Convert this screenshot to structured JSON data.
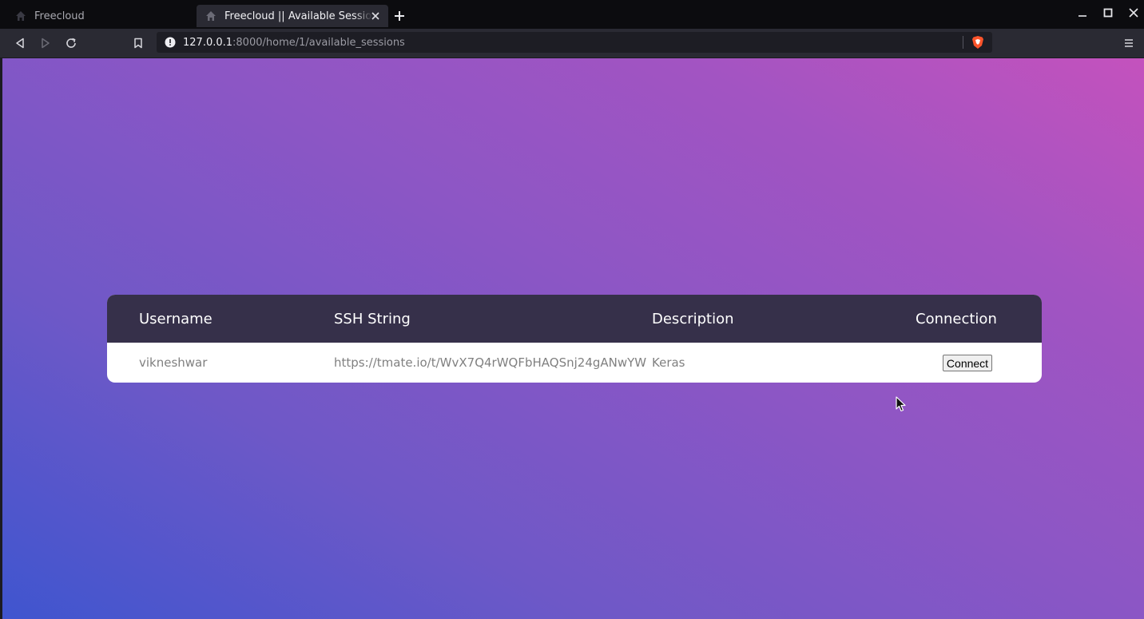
{
  "browser": {
    "tabs": [
      {
        "title": "Freecloud",
        "active": false,
        "icon": "home-icon"
      },
      {
        "title": "Freecloud || Available Sessions",
        "active": true,
        "icon": "home-icon"
      }
    ],
    "address_bar": {
      "host": "127.0.0.1",
      "rest": ":8000/home/1/available_sessions"
    }
  },
  "page": {
    "sessions_table": {
      "headers": {
        "username": "Username",
        "ssh_string": "SSH String",
        "description": "Description",
        "connection": "Connection"
      },
      "rows": [
        {
          "username": "vikneshwar",
          "ssh_string": "https://tmate.io/t/WvX7Q4rWQFbHAQSnj24gANwYW",
          "description": "Keras",
          "connect_label": "Connect"
        }
      ]
    }
  },
  "colors": {
    "table_header_bg": "#36304a",
    "gradient_start": "#3f55cf",
    "gradient_end": "#c452bd"
  }
}
